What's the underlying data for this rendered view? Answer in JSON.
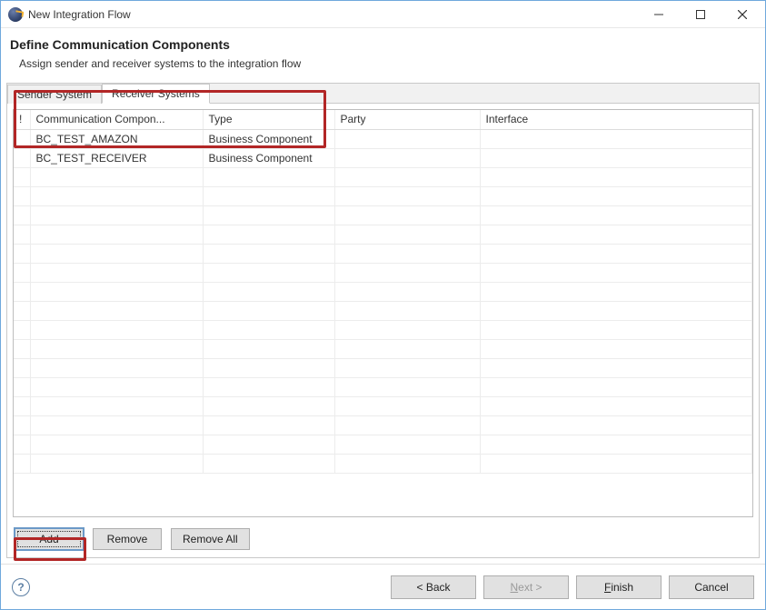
{
  "window": {
    "title": "New Integration Flow"
  },
  "header": {
    "title": "Define Communication Components",
    "description": "Assign sender and receiver systems to the integration flow"
  },
  "tabs": [
    {
      "label": "Sender System",
      "active": false
    },
    {
      "label": "Receiver Systems",
      "active": true
    }
  ],
  "columns": {
    "bang": "!",
    "component": "Communication Compon...",
    "type": "Type",
    "party": "Party",
    "interface": "Interface"
  },
  "rows": [
    {
      "component": "BC_TEST_AMAZON",
      "type": "Business Component",
      "party": "",
      "interface": ""
    },
    {
      "component": "BC_TEST_RECEIVER",
      "type": "Business Component",
      "party": "",
      "interface": ""
    }
  ],
  "tableButtons": {
    "add": "Add",
    "remove": "Remove",
    "removeAll": "Remove All"
  },
  "footer": {
    "back_full": "< Back",
    "next_prefix": "N",
    "next_rest": "ext >",
    "finish_prefix": "F",
    "finish_rest": "inish",
    "cancel": "Cancel",
    "help": "?"
  }
}
